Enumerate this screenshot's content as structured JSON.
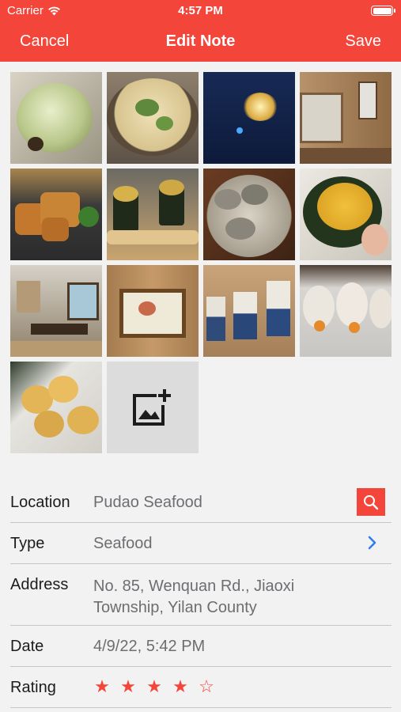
{
  "status_bar": {
    "carrier": "Carrier",
    "time": "4:57 PM"
  },
  "nav": {
    "cancel": "Cancel",
    "title": "Edit Note",
    "save": "Save"
  },
  "colors": {
    "accent": "#f4453a",
    "link": "#2f7ef2",
    "value_text": "#6d6d72"
  },
  "photos": {
    "count": 13,
    "add_icon": "add-photo-icon"
  },
  "form": {
    "location": {
      "label": "Location",
      "value": "Pudao Seafood",
      "action_icon": "search-icon"
    },
    "type": {
      "label": "Type",
      "value": "Seafood",
      "action_icon": "chevron-right-icon"
    },
    "address": {
      "label": "Address",
      "value": "No. 85, Wenquan Rd., Jiaoxi Township, Yilan County"
    },
    "date": {
      "label": "Date",
      "value": "4/9/22, 5:42 PM"
    },
    "rating": {
      "label": "Rating",
      "value": 4,
      "max": 5
    }
  }
}
